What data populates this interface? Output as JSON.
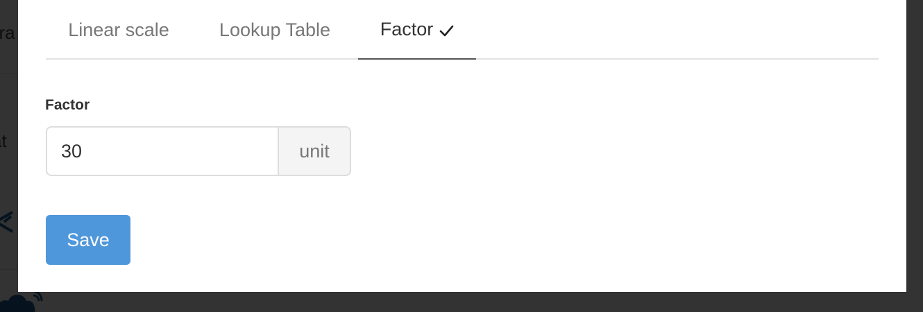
{
  "background": {
    "partial_text_1": "era",
    "partial_text_2": "at",
    "icons": [
      "snowflake-icon",
      "cloud-icon"
    ]
  },
  "tabs": [
    {
      "label": "Linear scale",
      "active": false
    },
    {
      "label": "Lookup Table",
      "active": false
    },
    {
      "label": "Factor",
      "active": true,
      "icon": "check-icon"
    }
  ],
  "form": {
    "factor_label": "Factor",
    "factor_value": "30",
    "unit_addon": "unit",
    "save_label": "Save"
  },
  "colors": {
    "primary_button": "#4f97db",
    "overlay": "#3a3a3a",
    "active_tab_underline": "#555555"
  }
}
